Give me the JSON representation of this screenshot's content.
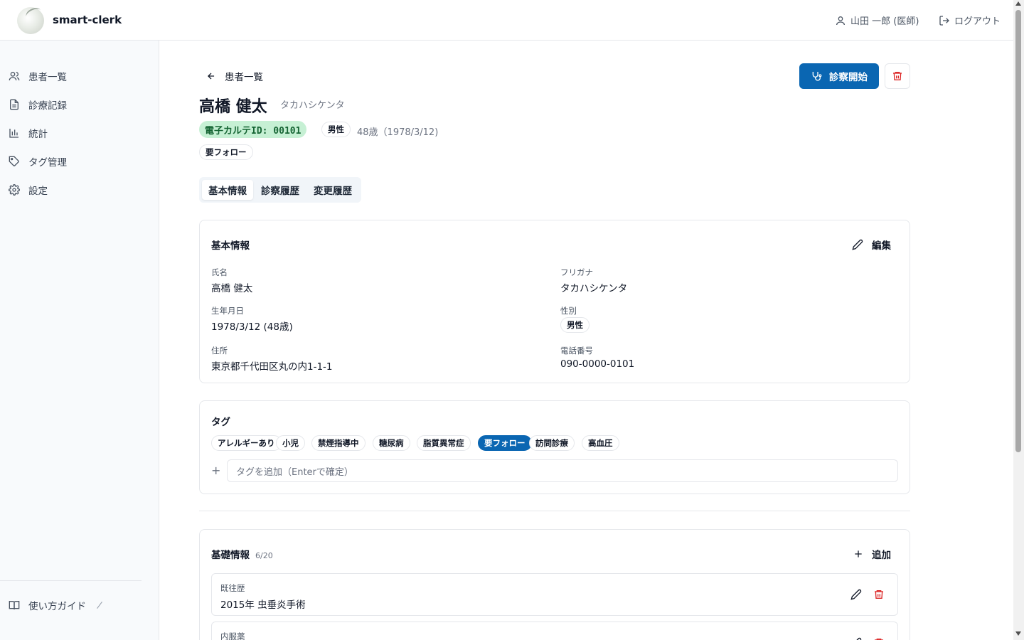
{
  "app": {
    "name": "smart-clerk"
  },
  "header": {
    "user": "山田 一郎 (医師)",
    "logout": "ログアウト"
  },
  "sidebar": {
    "items": [
      {
        "label": "患者一覧",
        "icon": "users-icon"
      },
      {
        "label": "診療記録",
        "icon": "document-icon"
      },
      {
        "label": "統計",
        "icon": "bar-chart-icon"
      },
      {
        "label": "タグ管理",
        "icon": "tag-icon"
      },
      {
        "label": "設定",
        "icon": "gear-icon"
      }
    ],
    "guide": "使い方ガイド"
  },
  "page": {
    "back_label": "患者一覧",
    "start_exam": "診察開始",
    "patient_name": "高橋 健太",
    "patient_kana": "タカハシケンタ",
    "karte_id": "電子カルテID: 00101",
    "gender_badge": "男性",
    "age": "48歳（1978/3/12)",
    "follow_badge": "要フォロー",
    "tabs": [
      "基本情報",
      "診察履歴",
      "変更履歴"
    ],
    "active_tab": "基本情報"
  },
  "basic_info": {
    "title": "基本情報",
    "edit": "編集",
    "fields": {
      "name_label": "氏名",
      "name_value": "高橋 健太",
      "kana_label": "フリガナ",
      "kana_value": "タカハシケンタ",
      "birth_label": "生年月日",
      "birth_value": "1978/3/12 (48歳)",
      "gender_label": "性別",
      "gender_value": "男性",
      "address_label": "住所",
      "address_value": "東京都千代田区丸の内1-1-1",
      "phone_label": "電話番号",
      "phone_value": "090-0000-0101"
    }
  },
  "tags": {
    "title": "タグ",
    "items": [
      "アレルギーあり",
      "小児",
      "禁煙指導中",
      "糖尿病",
      "脂質異常症",
      "要フォロー",
      "訪問診療",
      "高血圧"
    ],
    "selected": "要フォロー",
    "input_placeholder": "タグを追加（Enterで確定）"
  },
  "foundation": {
    "title": "基礎情報",
    "count": "6/20",
    "add": "追加",
    "items": [
      {
        "label": "既往歴",
        "value": "2015年 虫垂炎手術"
      },
      {
        "label": "内服薬",
        "value": ""
      }
    ]
  },
  "colors": {
    "primary": "#0a66b2",
    "id_badge_bg": "#c6f0d4",
    "danger": "#dc2626"
  }
}
